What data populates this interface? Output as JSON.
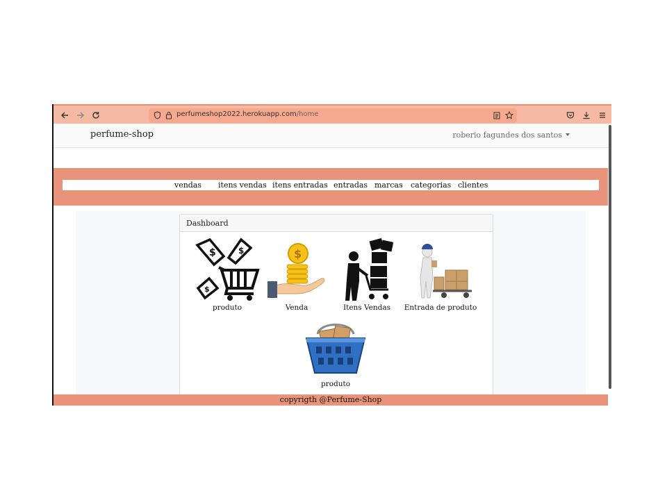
{
  "browser": {
    "url_host": "perfumeshop2022.herokuapp.com",
    "url_path": "/home"
  },
  "navbar": {
    "brand": "perfume-shop",
    "user": "roberio fagundes dos santos"
  },
  "menu": {
    "items": [
      "vendas",
      "itens vendas",
      "itens entradas",
      "entradas",
      "marcas",
      "categorias",
      "clientes"
    ]
  },
  "dashboard": {
    "title": "Dashboard",
    "tiles": [
      {
        "label": "produto",
        "icon": "price-tags-cart-icon"
      },
      {
        "label": "Venda",
        "icon": "hand-coins-icon"
      },
      {
        "label": "Itens Vendas",
        "icon": "person-boxes-cart-icon"
      },
      {
        "label": "Entrada de produto",
        "icon": "worker-hand-truck-icon"
      },
      {
        "label": "produto",
        "icon": "basket-boxes-icon"
      }
    ]
  },
  "footer": {
    "text": "copyrigth @Perfume-Shop"
  },
  "colors": {
    "toolbar": "#f6b9a4",
    "accent": "#e9937a",
    "urlbar": "#f6a98f"
  }
}
